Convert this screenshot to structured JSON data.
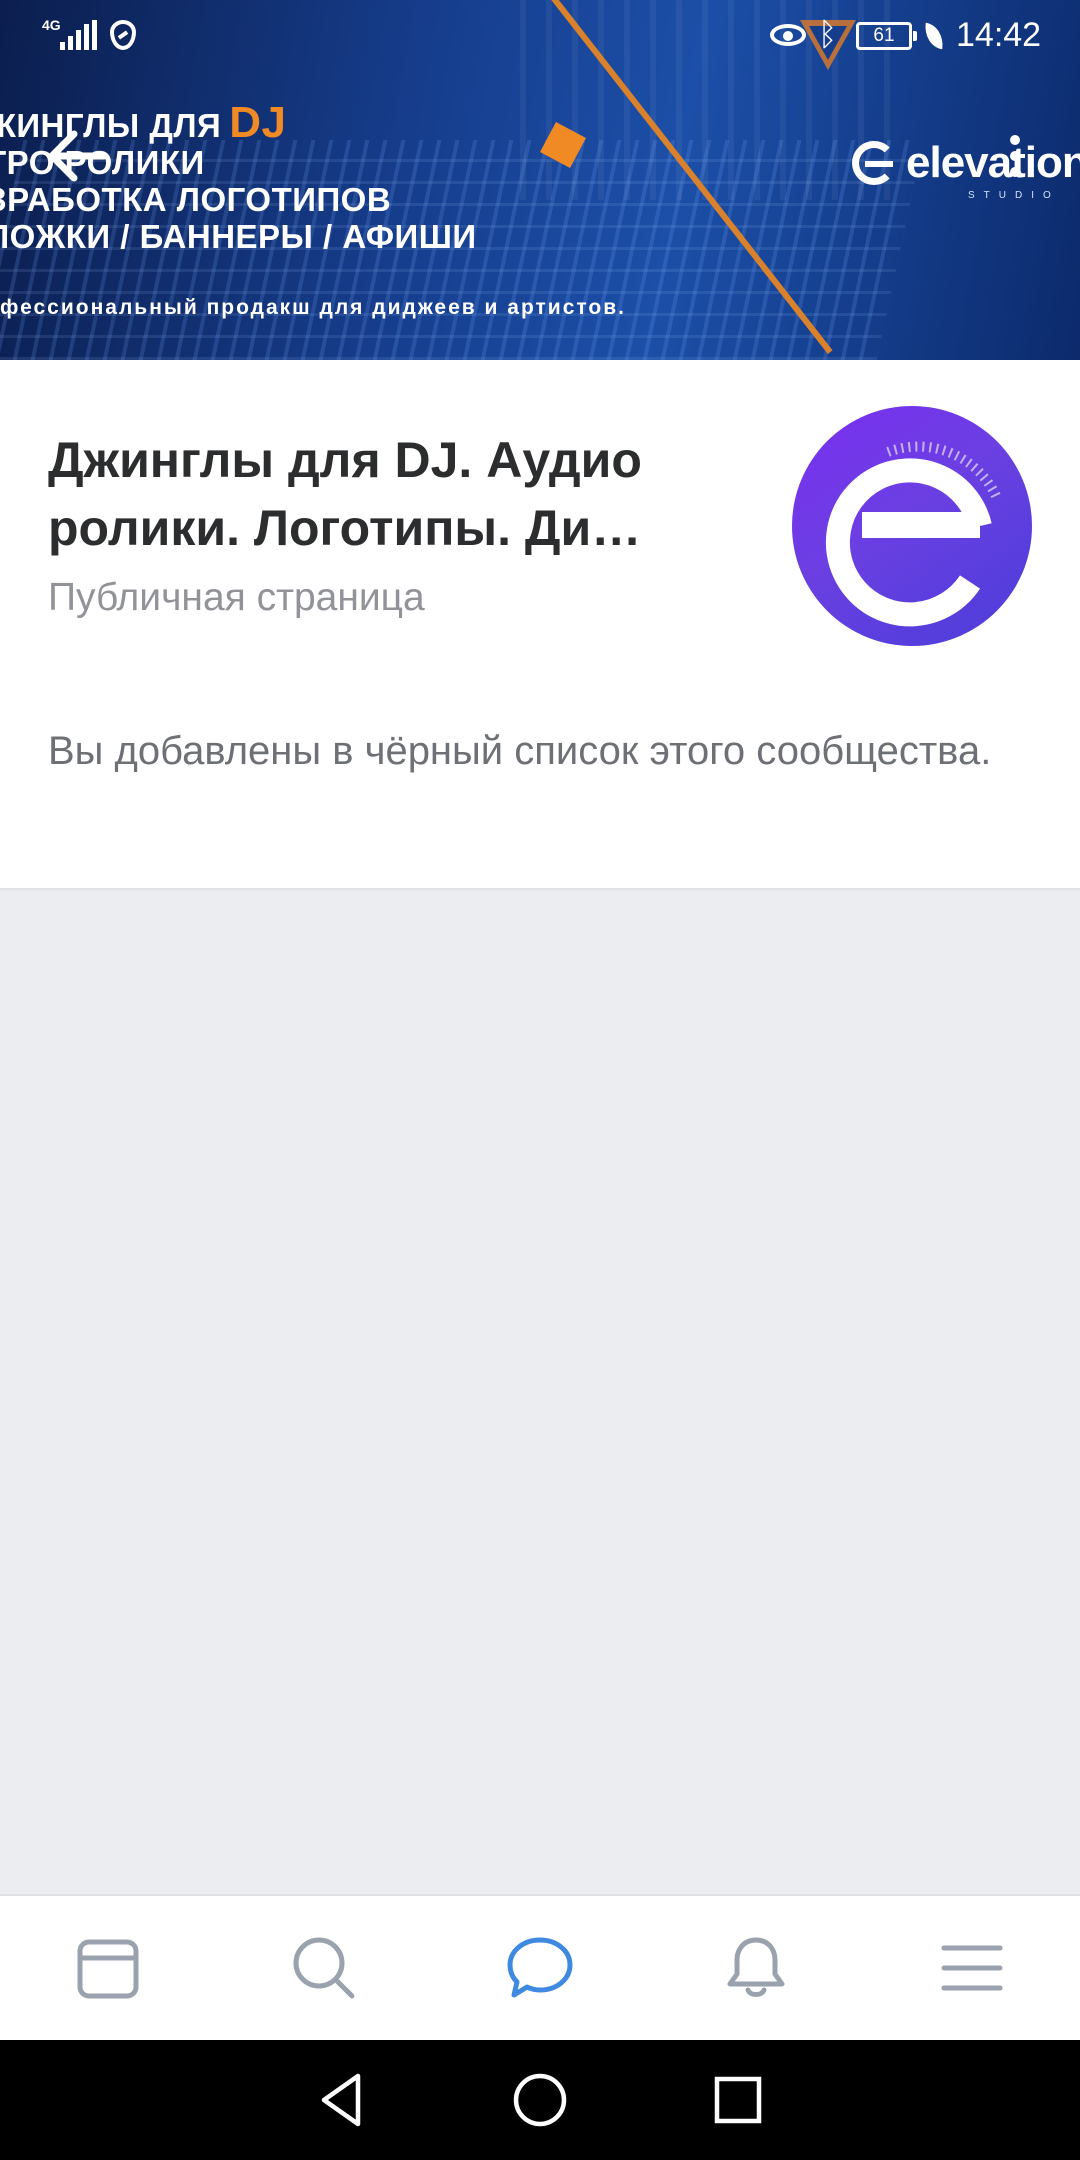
{
  "status_bar": {
    "network": "4G",
    "battery": "61",
    "time": "14:42"
  },
  "cover": {
    "lines": [
      "ЖИНГЛЫ ДЛЯ",
      "ТРО РОЛИКИ",
      "ЗРАБОТКА ЛОГОТИПОВ",
      "ЛОЖКИ / БАННЕРЫ / АФИШИ"
    ],
    "dj": "DJ",
    "tagline": "фессиональный продакш для диджеев и артистов.",
    "logo_word": "elevation",
    "logo_sub": "STUDIO"
  },
  "group": {
    "name": "Джинглы для DJ. Аудио ролики. Логотипы. Ди…",
    "type": "Публичная страница",
    "message": "Вы добавлены в чёрный список этого сообщества."
  },
  "tabs": [
    {
      "name": "news",
      "icon": "news-feed-icon",
      "active": false
    },
    {
      "name": "search",
      "icon": "search-icon",
      "active": false
    },
    {
      "name": "messages",
      "icon": "message-bubble-icon",
      "active": true
    },
    {
      "name": "notifications",
      "icon": "bell-icon",
      "active": false
    },
    {
      "name": "menu",
      "icon": "hamburger-menu-icon",
      "active": false
    }
  ],
  "colors": {
    "accent": "#3f8ae0",
    "tab_inactive": "#99a2ad",
    "cover_orange": "#f08a24"
  }
}
